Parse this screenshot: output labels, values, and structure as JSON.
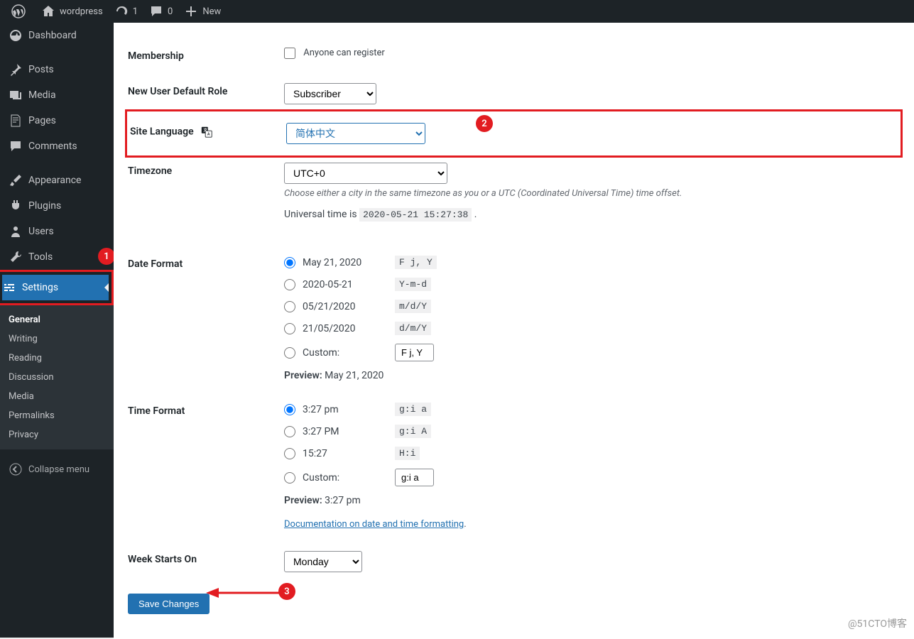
{
  "adminbar": {
    "site_name": "wordpress",
    "updates_count": "1",
    "comments_count": "0",
    "new_label": "New"
  },
  "sidebar": {
    "dashboard": "Dashboard",
    "posts": "Posts",
    "media": "Media",
    "pages": "Pages",
    "comments": "Comments",
    "appearance": "Appearance",
    "plugins": "Plugins",
    "users": "Users",
    "tools": "Tools",
    "settings": "Settings",
    "collapse": "Collapse menu",
    "submenu": {
      "general": "General",
      "writing": "Writing",
      "reading": "Reading",
      "discussion": "Discussion",
      "media": "Media",
      "permalinks": "Permalinks",
      "privacy": "Privacy"
    }
  },
  "labels": {
    "membership": "Membership",
    "anyone_can_register": "Anyone can register",
    "new_user_role": "New User Default Role",
    "site_language": "Site Language",
    "timezone": "Timezone",
    "date_format": "Date Format",
    "time_format": "Time Format",
    "week_starts": "Week Starts On",
    "custom": "Custom:",
    "preview": "Preview:"
  },
  "values": {
    "role_selected": "Subscriber",
    "language_selected": "简体中文",
    "timezone_selected": "UTC+0",
    "timezone_desc": "Choose either a city in the same timezone as you or a UTC (Coordinated Universal Time) time offset.",
    "universal_time_prefix": "Universal time is ",
    "universal_time": "2020-05-21 15:27:38",
    "date_opt1": "May 21, 2020",
    "date_fmt1": "F j, Y",
    "date_opt2": "2020-05-21",
    "date_fmt2": "Y-m-d",
    "date_opt3": "05/21/2020",
    "date_fmt3": "m/d/Y",
    "date_opt4": "21/05/2020",
    "date_fmt4": "d/m/Y",
    "date_custom_val": "F j, Y",
    "date_preview": "May 21, 2020",
    "time_opt1": "3:27 pm",
    "time_fmt1": "g:i a",
    "time_opt2": "3:27 PM",
    "time_fmt2": "g:i A",
    "time_opt3": "15:27",
    "time_fmt3": "H:i",
    "time_custom_val": "g:i a",
    "time_preview": "3:27 pm",
    "doc_link": "Documentation on date and time formatting",
    "week_selected": "Monday",
    "save_button": "Save Changes"
  },
  "annotations": {
    "badge1": "1",
    "badge2": "2",
    "badge3": "3"
  },
  "watermark": "@51CTO博客"
}
